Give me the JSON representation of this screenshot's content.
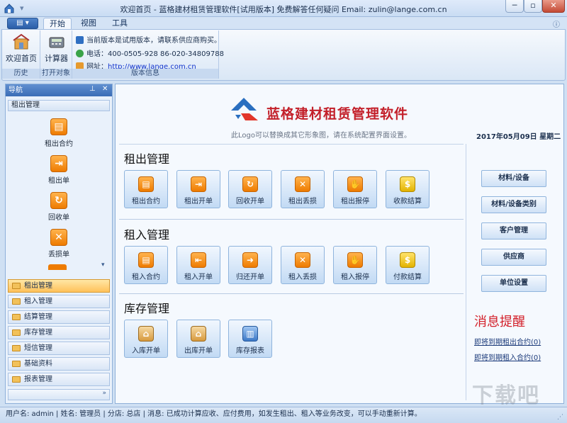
{
  "window": {
    "title": "欢迎首页 - 蓝格建材租赁管理软件[试用版本] 免费解答任何疑问 Email: zulin@lange.com.cn",
    "minimize": "─",
    "restore": "▫",
    "close": "✕"
  },
  "ribbon": {
    "tabs": [
      "开始",
      "视图",
      "工具"
    ],
    "groups": {
      "history": {
        "label": "历史",
        "button": "欢迎首页"
      },
      "open": {
        "label": "打开对象",
        "button": "计算器"
      },
      "version": {
        "label": "版本信息",
        "notice": "当前版本是试用版本，请联系供应商购买。",
        "phone_label": "电话：",
        "phone": "400-0505-928  86-020-34809788",
        "site_label": "网址：",
        "site": "http://www.lange.com.cn"
      }
    }
  },
  "nav": {
    "header": "导航",
    "pin": "⊥",
    "close": "✕",
    "current_group": "租出管理",
    "items": [
      {
        "label": "租出合约",
        "icon": "contract-icon",
        "glyph": "▤"
      },
      {
        "label": "租出单",
        "icon": "export-icon",
        "glyph": "⇥"
      },
      {
        "label": "回收单",
        "icon": "recycle-icon",
        "glyph": "↻"
      },
      {
        "label": "丢损单",
        "icon": "loss-icon",
        "glyph": "✕"
      }
    ],
    "groups": [
      "租出管理",
      "租入管理",
      "结算管理",
      "库存管理",
      "短信管理",
      "基础资料",
      "报表管理"
    ]
  },
  "main": {
    "logo_title": "蓝格建材租赁管理软件",
    "logo_hint": "此Logo可以替换成其它形象图，请在系统配置界面设置。",
    "date": "2017年05月09日 星期二",
    "sections": [
      {
        "title": "租出管理",
        "tiles": [
          {
            "label": "租出合约",
            "icon": "contract-icon",
            "glyph": "▤"
          },
          {
            "label": "租出开单",
            "icon": "export-icon",
            "glyph": "⇥"
          },
          {
            "label": "回收开单",
            "icon": "recycle-icon",
            "glyph": "↻"
          },
          {
            "label": "租出丢损",
            "icon": "loss-icon",
            "glyph": "✕"
          },
          {
            "label": "租出报停",
            "icon": "stop-hand-icon",
            "glyph": "✋"
          },
          {
            "label": "收款结算",
            "icon": "coins-icon",
            "glyph": "$"
          }
        ]
      },
      {
        "title": "租入管理",
        "tiles": [
          {
            "label": "租入合约",
            "icon": "contract-icon",
            "glyph": "▤"
          },
          {
            "label": "租入开单",
            "icon": "import-icon",
            "glyph": "⇤"
          },
          {
            "label": "归还开单",
            "icon": "return-icon",
            "glyph": "➜"
          },
          {
            "label": "租入丢损",
            "icon": "loss-icon",
            "glyph": "✕"
          },
          {
            "label": "租入报停",
            "icon": "stop-hand-icon",
            "glyph": "✋"
          },
          {
            "label": "付款结算",
            "icon": "coins-icon",
            "glyph": "$"
          }
        ]
      },
      {
        "title": "库存管理",
        "tiles": [
          {
            "label": "入库开单",
            "icon": "warehouse-in-icon",
            "glyph": "⌂"
          },
          {
            "label": "出库开单",
            "icon": "warehouse-out-icon",
            "glyph": "⌂"
          },
          {
            "label": "库存报表",
            "icon": "report-chart-icon",
            "glyph": "▥"
          }
        ]
      }
    ],
    "right_buttons": [
      "材料/设备",
      "材料/设备类别",
      "客户管理",
      "供应商",
      "单位设置"
    ],
    "reminder_title": "消息提醒",
    "reminders": [
      "即将到期租出合约(0)",
      "即将到期租入合约(0)"
    ]
  },
  "status": "用户名: admin | 姓名: 管理员 | 分店: 总店 | 消息: 已成功计算应收、应付费用，如发生租出、租入等业务改变，可以手动重新计算。",
  "watermark": "下载吧",
  "colors": {
    "accent_orange": "#ee7b00",
    "logo_red": "#c3202a",
    "logo_blue": "#2a6fc0"
  }
}
